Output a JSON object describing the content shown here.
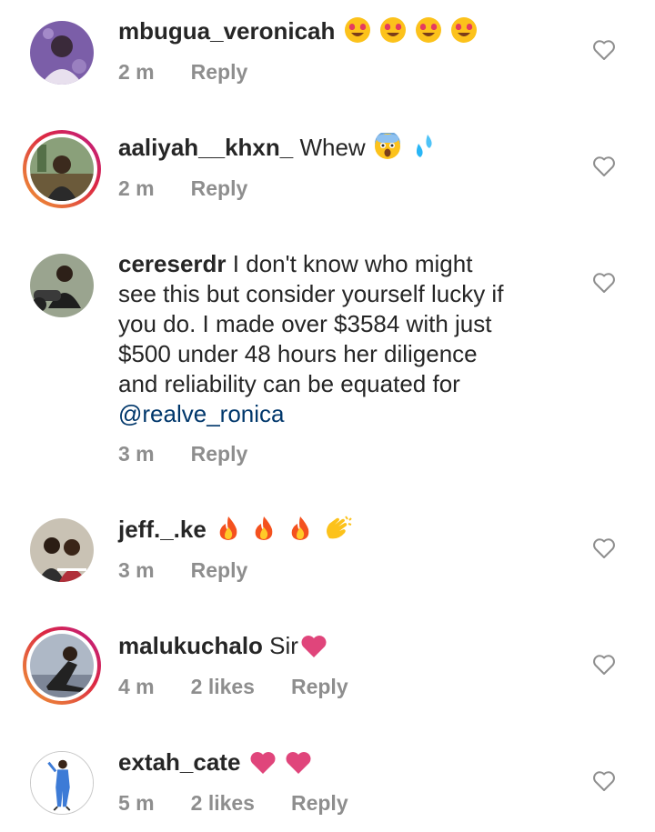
{
  "comments": [
    {
      "username": "mbugua_veronicah",
      "text": "",
      "emojis": [
        "heart-eyes-emoji",
        "heart-eyes-emoji",
        "heart-eyes-emoji",
        "heart-eyes-emoji"
      ],
      "time": "2 m",
      "likes": "",
      "reply": "Reply"
    },
    {
      "username": "aaliyah__khxn_",
      "text": "Whew",
      "emojis": [
        "scream-emoji",
        "sweat-droplets-emoji"
      ],
      "time": "2 m",
      "likes": "",
      "reply": "Reply"
    },
    {
      "username": "cereserdr",
      "text_lines": [
        "I don't know who might",
        "see this but consider yourself lucky if",
        "you do. I made over $3584 with just",
        "$500 under 48 hours her diligence",
        "and reliability can be equated for"
      ],
      "mention": "@realve_ronica",
      "time": "3 m",
      "likes": "",
      "reply": "Reply"
    },
    {
      "username": "jeff._.ke",
      "text": "",
      "emojis": [
        "fire-emoji",
        "fire-emoji",
        "fire-emoji",
        "clapping-hands-emoji"
      ],
      "time": "3 m",
      "likes": "",
      "reply": "Reply"
    },
    {
      "username": "malukuchalo",
      "text": "Sir",
      "emojis": [
        "heart-emoji"
      ],
      "time": "4 m",
      "likes": "2 likes",
      "reply": "Reply"
    },
    {
      "username": "extah_cate",
      "text": "",
      "emojis": [
        "heart-emoji",
        "heart-emoji"
      ],
      "time": "5 m",
      "likes": "2 likes",
      "reply": "Reply"
    }
  ],
  "icons": {
    "like": "heart-outline-icon"
  },
  "colors": {
    "username": "#262626",
    "meta": "#8e8e8e",
    "mention": "#00376b",
    "heart_emoji": "#e0457b"
  }
}
